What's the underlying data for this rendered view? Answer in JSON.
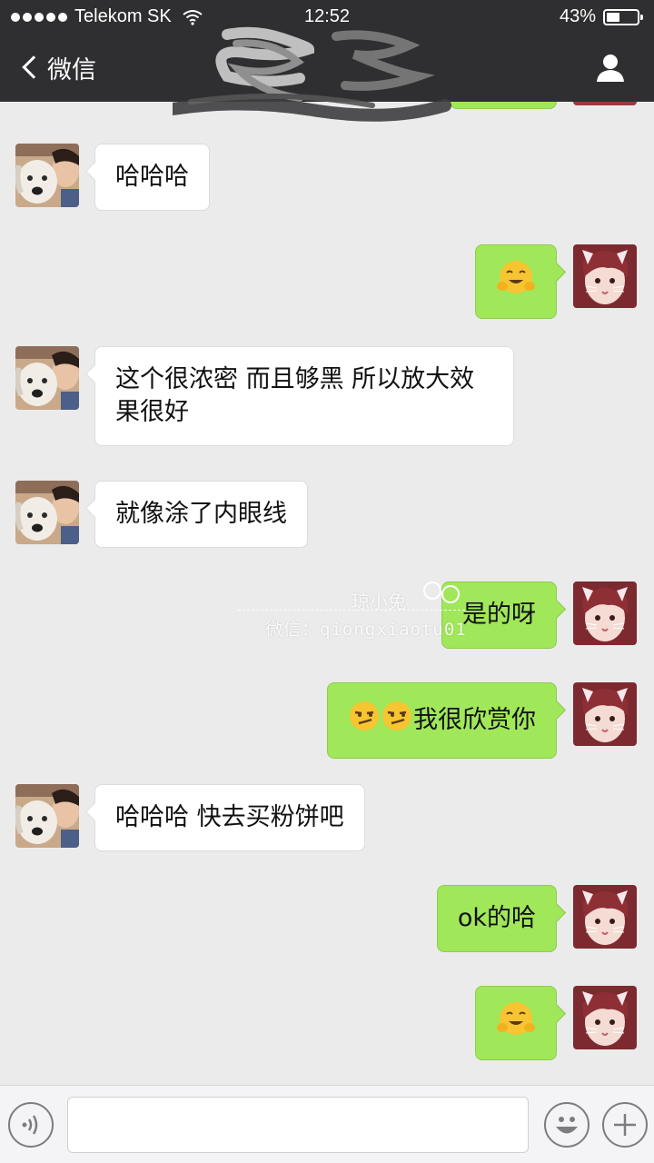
{
  "status_bar": {
    "carrier": "Telekom SK",
    "time": "12:52",
    "battery_percent": "43%",
    "battery_level": 0.43
  },
  "nav": {
    "back_label": "微信"
  },
  "messages": [
    {
      "side": "in",
      "text": "哈哈哈"
    },
    {
      "side": "out",
      "emoji": "smiling-hug-emoji"
    },
    {
      "side": "in",
      "text": "这个很浓密 而且够黑 所以放大效果很好"
    },
    {
      "side": "in",
      "text": "就像涂了内眼线"
    },
    {
      "side": "out",
      "text": "是的呀"
    },
    {
      "side": "out",
      "text": "我很欣赏你",
      "leading_emoji": [
        "smirk-emoji",
        "smirk-emoji"
      ]
    },
    {
      "side": "in",
      "text": "哈哈哈 快去买粉饼吧"
    },
    {
      "side": "out",
      "text": "ok的哈"
    },
    {
      "side": "out",
      "emoji": "smiling-hug-emoji"
    }
  ],
  "watermark": {
    "name": "琼小兔",
    "wechat": "微信：qiongxiaotu01"
  },
  "input": {
    "value": ""
  },
  "colors": {
    "header_bg": "#2f2f31",
    "chat_bg": "#ebebeb",
    "outgoing_bubble": "#a0e75a",
    "incoming_bubble": "#ffffff"
  }
}
